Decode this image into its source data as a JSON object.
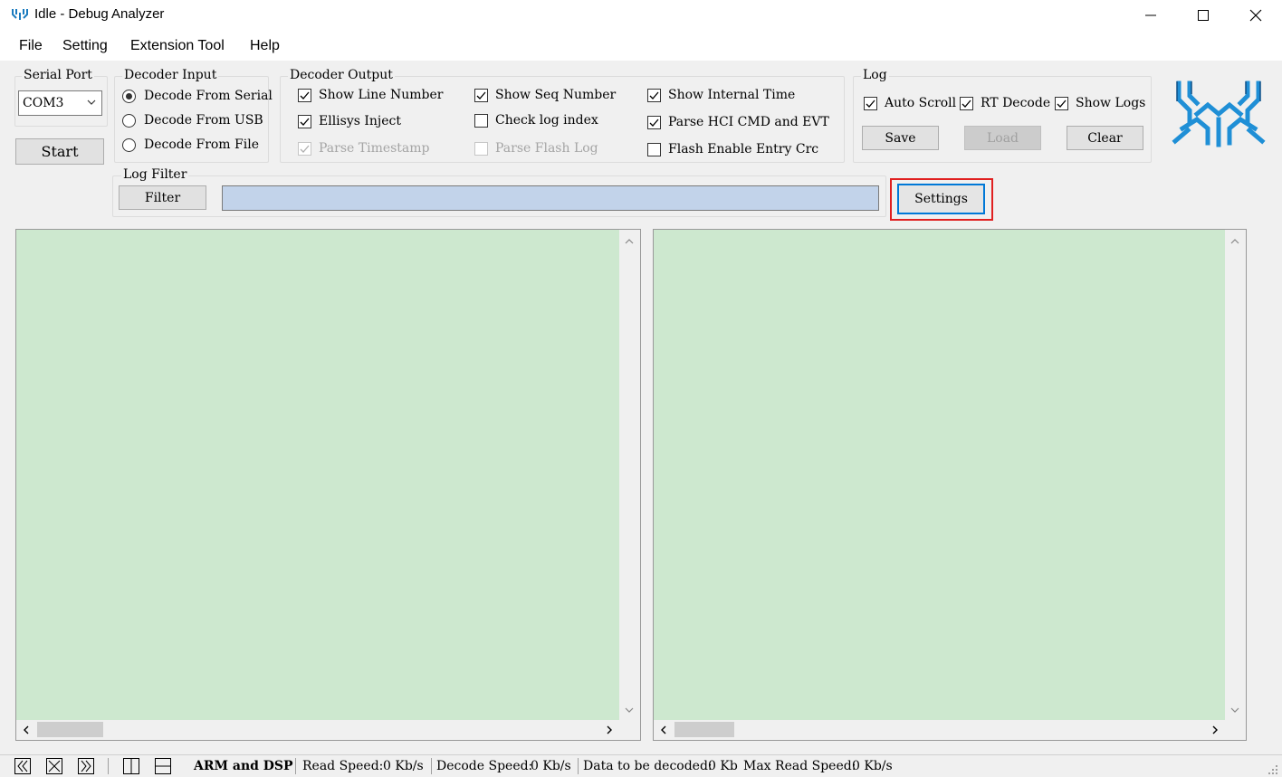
{
  "window": {
    "title": "Idle - Debug Analyzer",
    "icon": "realtek-logo-icon"
  },
  "menu": [
    "File",
    "Setting",
    "Extension Tool",
    "Help"
  ],
  "serial_port": {
    "label": "Serial Port",
    "selected": "COM3",
    "start_label": "Start"
  },
  "decoder_input": {
    "label": "Decoder Input",
    "options": [
      {
        "label": "Decode From Serial",
        "selected": true
      },
      {
        "label": "Decode From USB",
        "selected": false
      },
      {
        "label": "Decode From File",
        "selected": false
      }
    ]
  },
  "decoder_output": {
    "label": "Decoder Output",
    "options": [
      {
        "label": "Show Line Number",
        "checked": true,
        "enabled": true
      },
      {
        "label": "Ellisys Inject",
        "checked": true,
        "enabled": true
      },
      {
        "label": "Parse Timestamp",
        "checked": true,
        "enabled": false
      },
      {
        "label": "Show Seq Number",
        "checked": true,
        "enabled": true
      },
      {
        "label": "Check log index",
        "checked": false,
        "enabled": true
      },
      {
        "label": "Parse Flash Log",
        "checked": false,
        "enabled": false
      },
      {
        "label": "Show Internal Time",
        "checked": true,
        "enabled": true
      },
      {
        "label": "Parse HCI CMD and EVT",
        "checked": true,
        "enabled": true
      },
      {
        "label": "Flash Enable Entry Crc",
        "checked": false,
        "enabled": true
      }
    ]
  },
  "log": {
    "label": "Log",
    "options": [
      {
        "label": "Auto Scroll",
        "checked": true
      },
      {
        "label": "RT Decode",
        "checked": true
      },
      {
        "label": "Show Logs",
        "checked": true
      }
    ],
    "save_label": "Save",
    "load_label": "Load",
    "clear_label": "Clear"
  },
  "log_filter": {
    "label": "Log Filter",
    "filter_label": "Filter",
    "value": "",
    "settings_label": "Settings"
  },
  "colors": {
    "panel_bg": "#cde8cf",
    "filter_bg": "#c2d3ea",
    "highlight": "#e02020",
    "focus": "#0078d7"
  },
  "status": {
    "mode": "ARM and DSP",
    "read_speed_label": "Read Speed:",
    "read_speed": "0 Kb/s",
    "decode_speed_label": "Decode Speed:",
    "decode_speed": "0 Kb/s",
    "pending_label": "Data to be decoded:",
    "pending": "0 Kb",
    "max_read_label": "Max Read Speed:",
    "max_read": "0 Kb/s"
  }
}
